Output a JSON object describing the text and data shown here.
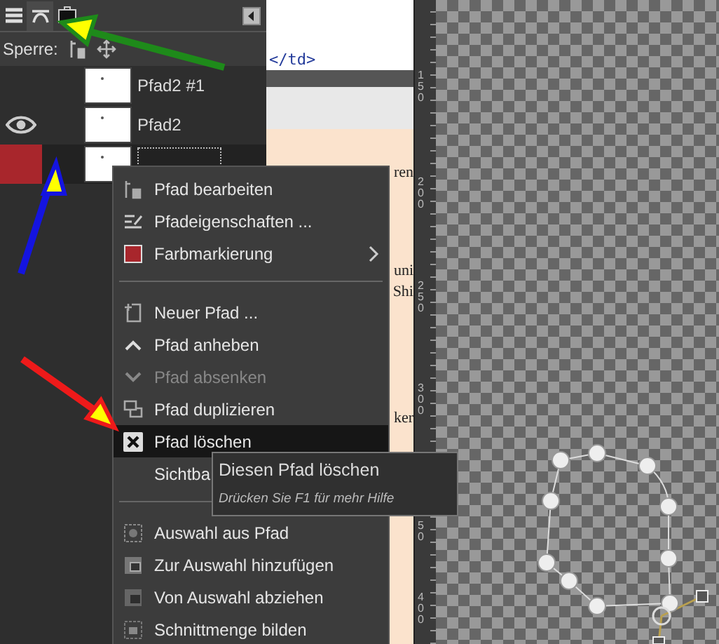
{
  "dock": {
    "tabs": [
      {
        "kind": "layers",
        "selected": false
      },
      {
        "kind": "paths",
        "selected": true
      },
      {
        "kind": "channels",
        "selected": false
      }
    ],
    "lock_label": "Sperre:",
    "paths": [
      {
        "name": "Pfad2 #1",
        "visible": false,
        "selected": false,
        "editing": false
      },
      {
        "name": "Pfad2",
        "visible": true,
        "selected": false,
        "editing": false
      },
      {
        "visible": false,
        "color": "#a8262c",
        "selected": true,
        "editing": true
      }
    ]
  },
  "background": {
    "code_text": "</td>",
    "fragments": [
      "ren",
      "uni",
      "Shi",
      "ker"
    ]
  },
  "ruler": {
    "labels": [
      "150",
      "200",
      "250",
      "300",
      "50",
      "400"
    ]
  },
  "context_menu": {
    "items": [
      {
        "kind": "edit",
        "label": "Pfad bearbeiten",
        "disabled": false,
        "selected": false,
        "submenu": false
      },
      {
        "kind": "properties",
        "label": "Pfadeigenschaften ...",
        "disabled": false,
        "selected": false,
        "submenu": false
      },
      {
        "kind": "swatch",
        "label": "Farbmarkierung",
        "disabled": false,
        "selected": false,
        "submenu": true
      },
      {
        "kind": "separator"
      },
      {
        "kind": "new",
        "label": "Neuer Pfad ...",
        "disabled": false,
        "selected": false,
        "submenu": false
      },
      {
        "kind": "up",
        "label": "Pfad anheben",
        "disabled": false,
        "selected": false,
        "submenu": false
      },
      {
        "kind": "down",
        "label": "Pfad absenken",
        "disabled": true,
        "selected": false,
        "submenu": false
      },
      {
        "kind": "duplicate",
        "label": "Pfad duplizieren",
        "disabled": false,
        "selected": false,
        "submenu": false
      },
      {
        "kind": "delete",
        "label": "Pfad löschen",
        "disabled": false,
        "selected": true,
        "submenu": false
      },
      {
        "kind": "plain",
        "label": "Sichtba",
        "disabled": false,
        "selected": false,
        "submenu": false
      },
      {
        "kind": "separator"
      },
      {
        "kind": "selection",
        "label": "Auswahl aus Pfad",
        "disabled": false,
        "selected": false,
        "submenu": false
      },
      {
        "kind": "add",
        "label": "Zur Auswahl hinzufügen",
        "disabled": false,
        "selected": false,
        "submenu": false
      },
      {
        "kind": "subtract",
        "label": "Von Auswahl abziehen",
        "disabled": false,
        "selected": false,
        "submenu": false
      },
      {
        "kind": "intersect",
        "label": "Schnittmenge bilden",
        "disabled": false,
        "selected": false,
        "submenu": false
      }
    ]
  },
  "tooltip": {
    "title": "Diesen Pfad löschen",
    "hint": "Drücken Sie F1 für mehr Hilfe"
  }
}
